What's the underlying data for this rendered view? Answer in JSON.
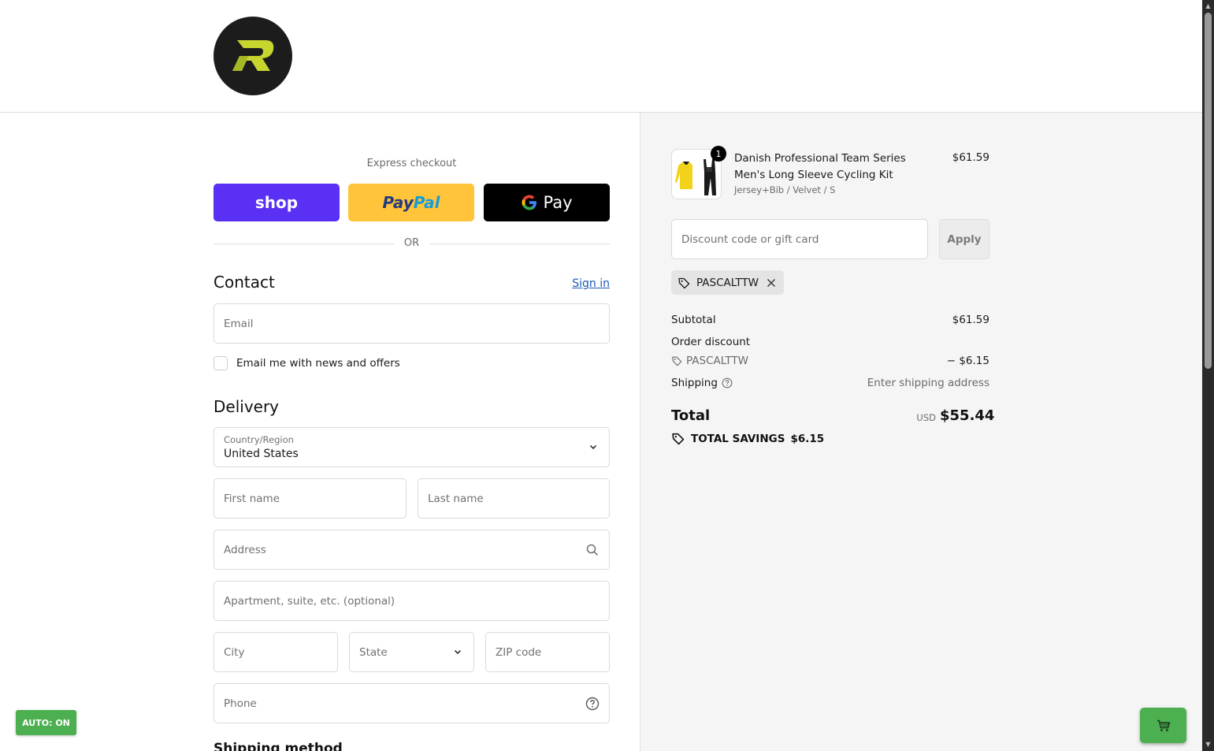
{
  "express": {
    "label": "Express checkout",
    "shop_label": "shop",
    "paypal_part1": "Pay",
    "paypal_part2": "Pal",
    "gpay_label": "Pay",
    "or_label": "OR"
  },
  "contact": {
    "title": "Contact",
    "signin_label": "Sign in",
    "email_placeholder": "Email",
    "newsletter_label": "Email me with news and offers"
  },
  "delivery": {
    "title": "Delivery",
    "country_label": "Country/Region",
    "country_value": "United States",
    "first_name_placeholder": "First name",
    "last_name_placeholder": "Last name",
    "address_placeholder": "Address",
    "apartment_placeholder": "Apartment, suite, etc. (optional)",
    "city_placeholder": "City",
    "state_placeholder": "State",
    "zip_placeholder": "ZIP code",
    "phone_placeholder": "Phone",
    "shipping_method_title": "Shipping method"
  },
  "order": {
    "item": {
      "quantity": "1",
      "name": "Danish Professional Team Series Men's Long Sleeve Cycling Kit",
      "variant": "Jersey+Bib / Velvet / S",
      "price": "$61.59"
    },
    "discount_placeholder": "Discount code or gift card",
    "apply_label": "Apply",
    "applied_code": "PASCALTTW",
    "subtotal_label": "Subtotal",
    "subtotal_value": "$61.59",
    "order_discount_label": "Order discount",
    "discount_code": "PASCALTTW",
    "discount_value": "− $6.15",
    "shipping_label": "Shipping",
    "shipping_value": "Enter shipping address",
    "total_label": "Total",
    "currency": "USD",
    "total_value": "$55.44",
    "savings_label": "TOTAL SAVINGS",
    "savings_value": "$6.15"
  },
  "overlay": {
    "auto_label": "AUTO: ON"
  },
  "colors": {
    "shop_purple": "#5a31f4",
    "paypal_yellow": "#ffc439",
    "gpay_black": "#000000",
    "link_blue": "#1a58b7",
    "logo_lime": "#c6d62f",
    "overlay_green": "#4caf50"
  }
}
